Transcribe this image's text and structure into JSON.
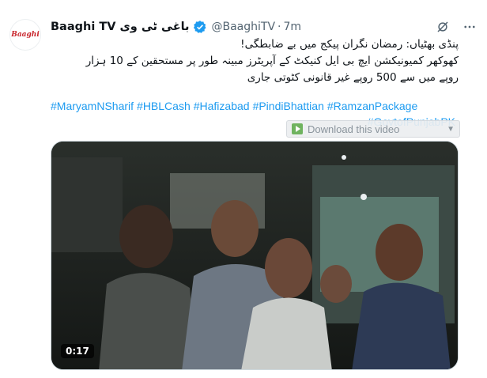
{
  "tweet": {
    "author_name": "Baaghi TV باغی ٹی وی",
    "handle": "@BaaghiTV",
    "separator": "·",
    "time": "7m",
    "avatar_text": "Baaghi",
    "body_lines": [
      "پنڈی بھٹیاں: رمضان نگران پیکج میں بے ضابطگی!",
      "کھوکھر کمیونیکشن ایچ بی ایل کنیکٹ کے آپریٹرز مبینہ طور پر مستحقین کے 10 ہزار",
      "روپے میں سے 500 روپے غیر قانونی کٹوتی جاری"
    ],
    "hashtags_line1": [
      "#MaryamNSharif",
      "#HBLCash",
      "#Hafizabad",
      "#PindiBhattian",
      "#RamzanPackage"
    ],
    "hashtags_line2": [
      "#GovtofPunjabPK"
    ]
  },
  "download_bar": {
    "label": "Download this video"
  },
  "video": {
    "duration": "0:17"
  },
  "icons": [
    "verified-badge-icon",
    "grok-icon",
    "more-icon",
    "download-play-icon"
  ],
  "colors": {
    "link": "#1d9bf0",
    "verified": "#1d9bf0",
    "secondary": "#536471"
  }
}
